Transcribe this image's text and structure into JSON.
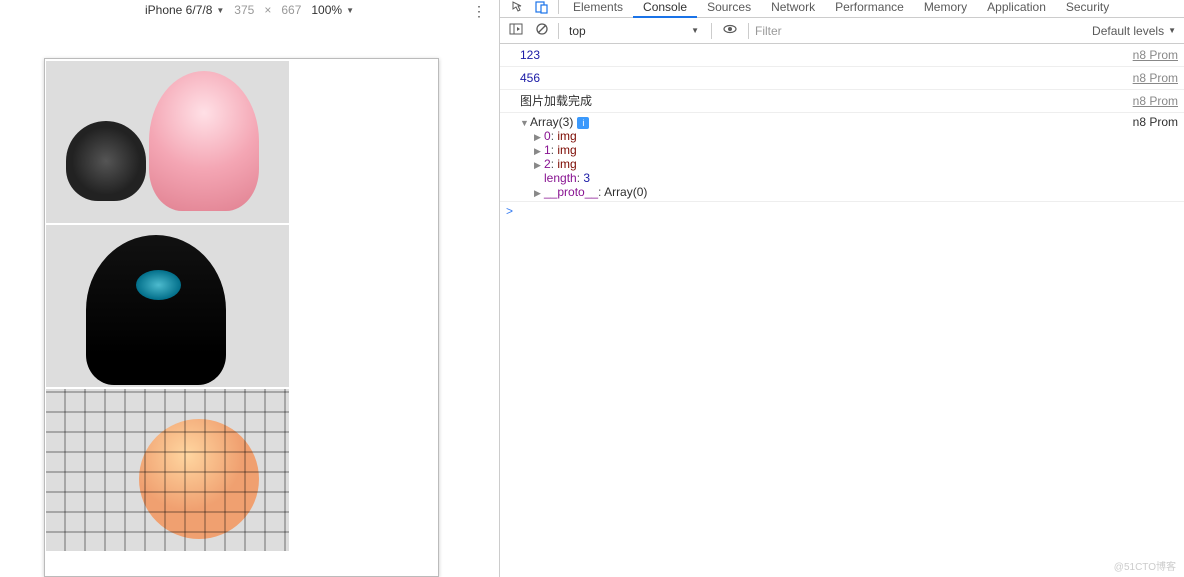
{
  "device_toolbar": {
    "device_name": "iPhone 6/7/8",
    "width": "375",
    "height": "667",
    "separator": "×",
    "zoom": "100%"
  },
  "devtools": {
    "tabs": [
      "Elements",
      "Console",
      "Sources",
      "Network",
      "Performance",
      "Memory",
      "Application",
      "Security"
    ],
    "active_tab": "Console",
    "toolbar": {
      "context": "top",
      "filter_placeholder": "Filter",
      "levels": "Default levels"
    },
    "logs": [
      {
        "text": "123",
        "type": "num",
        "src": "n8 Prom"
      },
      {
        "text": "456",
        "type": "num",
        "src": "n8 Prom"
      },
      {
        "text": "图片加载完成",
        "type": "str",
        "src": "n8 Prom"
      }
    ],
    "object_log": {
      "header": "Array(3)",
      "src": "n8 Prom",
      "items": [
        {
          "key": "0",
          "val": "img"
        },
        {
          "key": "1",
          "val": "img"
        },
        {
          "key": "2",
          "val": "img"
        }
      ],
      "length_key": "length",
      "length_val": "3",
      "proto_key": "__proto__",
      "proto_val": "Array(0)"
    },
    "prompt": ">"
  },
  "watermark": "@51CTO博客"
}
